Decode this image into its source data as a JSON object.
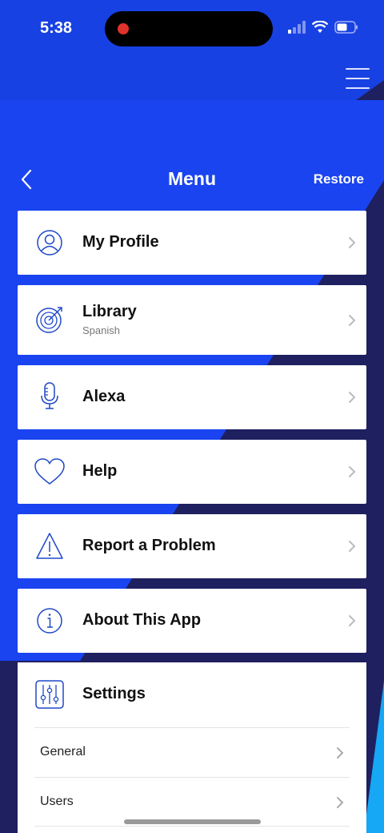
{
  "status_bar": {
    "time": "5:38"
  },
  "nav": {
    "title": "Menu",
    "restore_label": "Restore"
  },
  "menu": {
    "profile": {
      "label": "My Profile"
    },
    "library": {
      "label": "Library",
      "sublabel": "Spanish"
    },
    "alexa": {
      "label": "Alexa"
    },
    "help": {
      "label": "Help"
    },
    "report": {
      "label": "Report a Problem"
    },
    "about": {
      "label": "About This App"
    }
  },
  "settings": {
    "label": "Settings",
    "items": [
      {
        "label": "General"
      },
      {
        "label": "Users"
      }
    ]
  },
  "colors": {
    "brand_blue": "#1a44f0",
    "navy": "#1f2060",
    "cyan": "#16a8f4",
    "icon_blue": "#1f48c8"
  },
  "icons": [
    "user-icon",
    "target-icon",
    "microphone-icon",
    "heart-icon",
    "warning-icon",
    "info-icon",
    "sliders-icon",
    "chevron-right-icon",
    "back-chevron-icon",
    "hamburger-icon"
  ]
}
